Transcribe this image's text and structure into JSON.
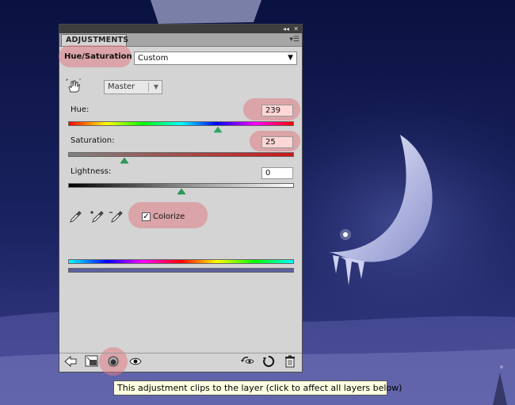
{
  "panel": {
    "tab_label": "ADJUSTMENTS",
    "adjustment_name": "Hue/Saturation",
    "preset": "Custom",
    "channel": "Master",
    "menu_icon": "panel-menu-icon"
  },
  "controls": {
    "hue": {
      "label": "Hue:",
      "value": "239",
      "slider_fraction": 0.664
    },
    "saturation": {
      "label": "Saturation:",
      "value": "25",
      "slider_fraction": 0.25
    },
    "lightness": {
      "label": "Lightness:",
      "value": "0",
      "slider_fraction": 0.5
    }
  },
  "colorize": {
    "label": "Colorize",
    "checked": true
  },
  "eyedroppers": [
    "eyedropper-icon",
    "eyedropper-plus-icon",
    "eyedropper-minus-icon"
  ],
  "footer_icons": [
    "back-arrow-icon",
    "expand-view-icon",
    "clip-to-layer-icon",
    "visibility-eye-icon",
    "view-previous-state-icon",
    "reset-icon",
    "trash-icon"
  ],
  "tooltip": "This adjustment clips to the layer (click to affect all layers below)",
  "colors": {
    "highlight": "#de7b84",
    "panel_bg": "#d4d4d4",
    "sky_top": "#0a1240",
    "sky_bottom": "#3c3f8a"
  }
}
